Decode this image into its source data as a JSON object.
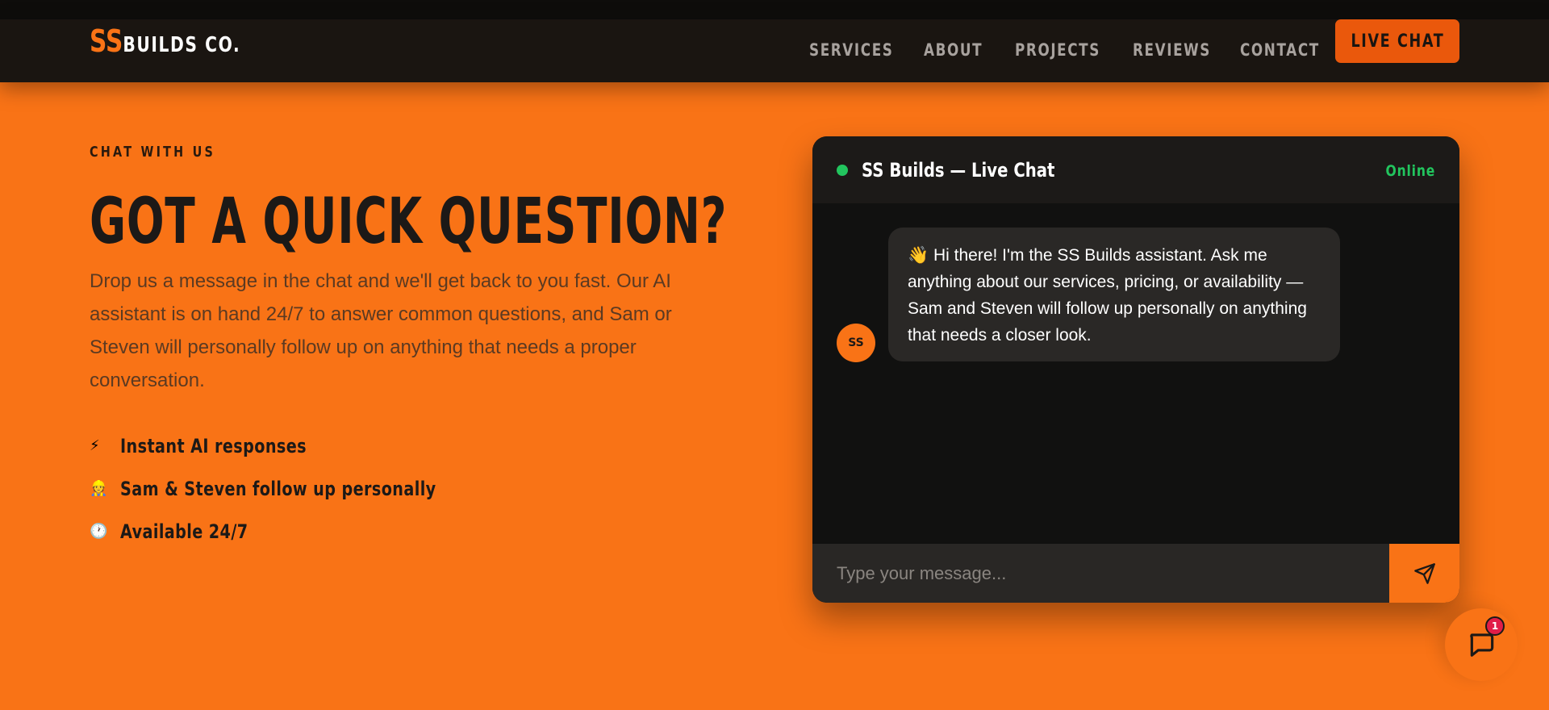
{
  "brand": {
    "accent": "SS",
    "name": "BUILDS CO."
  },
  "nav": {
    "items": [
      "SERVICES",
      "ABOUT",
      "PROJECTS",
      "REVIEWS",
      "CONTACT"
    ],
    "cta": "LIVE CHAT"
  },
  "hero": {
    "eyebrow": "CHAT WITH US",
    "title": "GOT A QUICK QUESTION?",
    "lead": "Drop us a message in the chat and we'll get back to you fast. Our AI assistant is on hand 24/7 to answer common questions, and Sam or Steven will personally follow up on anything that needs a proper conversation.",
    "features": [
      {
        "icon": "⚡",
        "icon_name": "lightning-icon",
        "text": "Instant AI responses"
      },
      {
        "icon": "👷",
        "icon_name": "worker-icon",
        "text": "Sam & Steven follow up personally"
      },
      {
        "icon": "🕐",
        "icon_name": "clock-icon",
        "text": "Available 24/7"
      }
    ]
  },
  "chat": {
    "title": "SS Builds — Live Chat",
    "status": "Online",
    "avatar": "SS",
    "message": "👋 Hi there! I'm the SS Builds assistant. Ask me anything about our services, pricing, or availability — Sam and Steven will follow up personally on anything that needs a closer look.",
    "input_placeholder": "Type your message..."
  },
  "fab": {
    "badge": "1"
  },
  "colors": {
    "accent": "#f97316",
    "header": "#1a1511",
    "online": "#22c55e",
    "badge": "#e11d48"
  }
}
